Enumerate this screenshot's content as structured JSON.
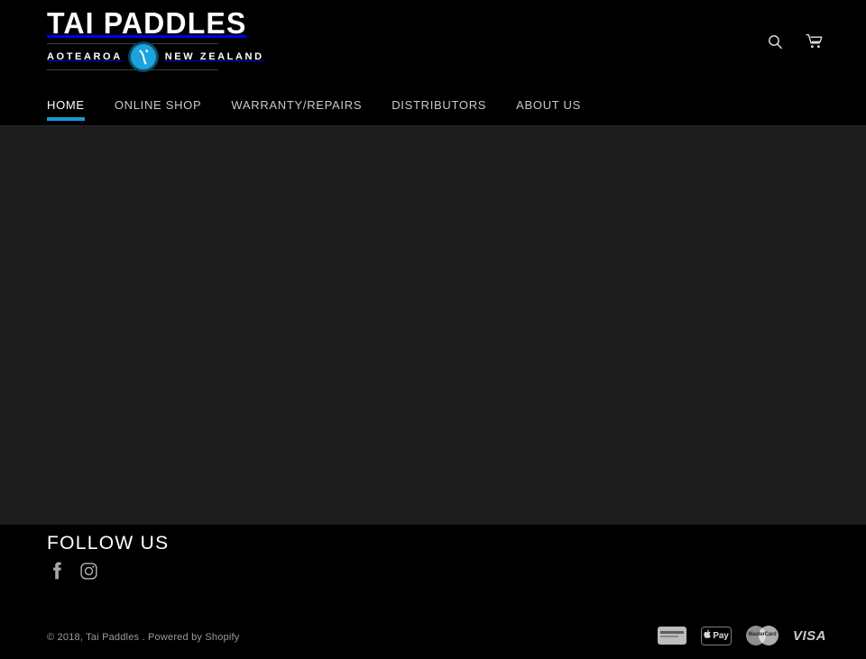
{
  "header": {
    "logo": {
      "title": "TAI PADDLES",
      "left_text": "AOTEAROA",
      "right_text": "NEW ZEALAND",
      "badge_icon": "new-zealand-islands-icon",
      "badge_color": "#1ba3dd"
    },
    "actions": [
      {
        "name": "search-icon",
        "label": "Search"
      },
      {
        "name": "cart-icon",
        "label": "Cart"
      }
    ]
  },
  "nav": {
    "active_index": 0,
    "accent_color": "#1c9ad4",
    "items": [
      {
        "label": "Home"
      },
      {
        "label": "Online Shop"
      },
      {
        "label": "Warranty/Repairs"
      },
      {
        "label": "Distributors"
      },
      {
        "label": "About us"
      }
    ]
  },
  "main": {
    "background_color": "#1c1c1c",
    "content": ""
  },
  "footer": {
    "heading": "Follow us",
    "social": [
      {
        "name": "facebook-icon",
        "label": "Facebook"
      },
      {
        "name": "instagram-icon",
        "label": "Instagram"
      }
    ],
    "copyright": "© 2018, Tai Paddles .",
    "powered_by": "Powered by Shopify",
    "payments": [
      {
        "name": "american-express-icon",
        "label": "American Express"
      },
      {
        "name": "apple-pay-icon",
        "label": "Apple Pay",
        "apple_mark": "",
        "pay_text": "Pay"
      },
      {
        "name": "master-card-icon",
        "label": "MasterCard",
        "short": "MasterCard"
      },
      {
        "name": "visa-icon",
        "label": "VISA"
      }
    ]
  }
}
